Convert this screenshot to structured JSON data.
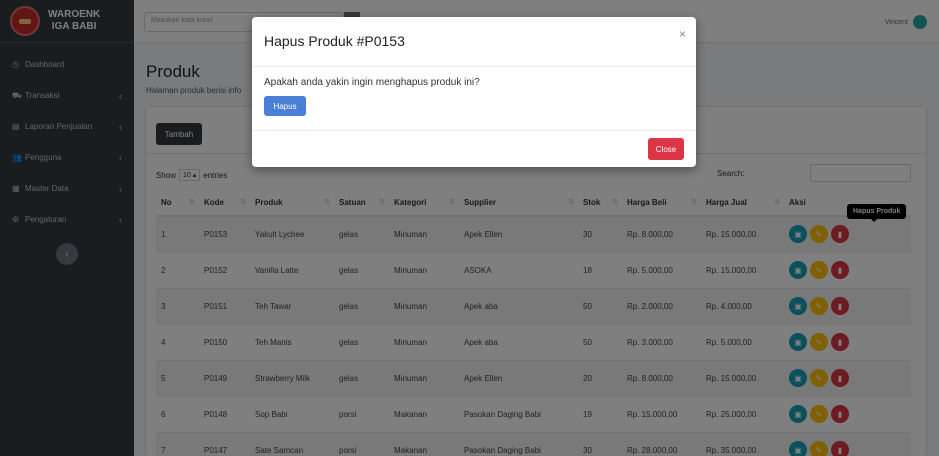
{
  "brand": {
    "line1": "WAROENK",
    "line2": "IGA BABI"
  },
  "sidebar": {
    "items": [
      {
        "label": "Dashboard",
        "icon": "dashboard-icon",
        "glyph": "◷",
        "arrow": ""
      },
      {
        "label": "Transaksi",
        "icon": "cart-icon",
        "glyph": "⛟",
        "arrow": "‹"
      },
      {
        "label": "Laporan Penjualan",
        "icon": "report-icon",
        "glyph": "▤",
        "arrow": "‹"
      },
      {
        "label": "Pengguna",
        "icon": "users-icon",
        "glyph": "👥",
        "arrow": "‹"
      },
      {
        "label": "Master Data",
        "icon": "database-icon",
        "glyph": "▦",
        "arrow": "‹"
      },
      {
        "label": "Pengaturan",
        "icon": "gear-icon",
        "glyph": "⚙",
        "arrow": "‹"
      }
    ],
    "collapse_glyph": "‹"
  },
  "topbar": {
    "search_placeholder": "Masukan kata kunci",
    "user": "Vincent"
  },
  "page": {
    "title": "Produk",
    "subtitle": "Halaman produk berisi info"
  },
  "card": {
    "add_label": "Tambah",
    "show_label": "Show",
    "entries_value": "10",
    "entries_label": "entries",
    "search_label": "Search:"
  },
  "table": {
    "headers": [
      "No",
      "Kode",
      "Produk",
      "Satuan",
      "Kategori",
      "Supplier",
      "Stok",
      "Harga Beli",
      "Harga Jual",
      "Aksi"
    ],
    "rows": [
      [
        "1",
        "P0153",
        "Yakult Lychee",
        "gelas",
        "Minuman",
        "Apek Ellen",
        "30",
        "Rp. 8.000,00",
        "Rp. 15.000,00"
      ],
      [
        "2",
        "P0152",
        "Vanilla Latte",
        "gelas",
        "Minuman",
        "ASOKA",
        "18",
        "Rp. 5.000,00",
        "Rp. 15.000,00"
      ],
      [
        "3",
        "P0151",
        "Teh Tawar",
        "gelas",
        "Minuman",
        "Apek aba",
        "50",
        "Rp. 2.000,00",
        "Rp. 4.000,00"
      ],
      [
        "4",
        "P0150",
        "Teh Manis",
        "gelas",
        "Minuman",
        "Apek aba",
        "50",
        "Rp. 3.000,00",
        "Rp. 5.000,00"
      ],
      [
        "5",
        "P0149",
        "Strawberry Milk",
        "gelas",
        "Minuman",
        "Apek Ellen",
        "20",
        "Rp. 8.000,00",
        "Rp. 15.000,00"
      ],
      [
        "6",
        "P0148",
        "Sop Babi",
        "porsi",
        "Makanan",
        "Pasokan Daging Babi",
        "19",
        "Rp. 15.000,00",
        "Rp. 25.000,00"
      ],
      [
        "7",
        "P0147",
        "Sate Samcan",
        "porsi",
        "Makanan",
        "Pasokan Daging Babi",
        "30",
        "Rp. 28.000,00",
        "Rp. 35.000,00"
      ]
    ]
  },
  "tooltip": "Hapus Produk",
  "modal": {
    "title": "Hapus Produk #P0153",
    "close_x": "×",
    "message": "Apakah anda yakin ingin menghapus produk ini?",
    "confirm_label": "Hapus",
    "close_label": "Close"
  }
}
